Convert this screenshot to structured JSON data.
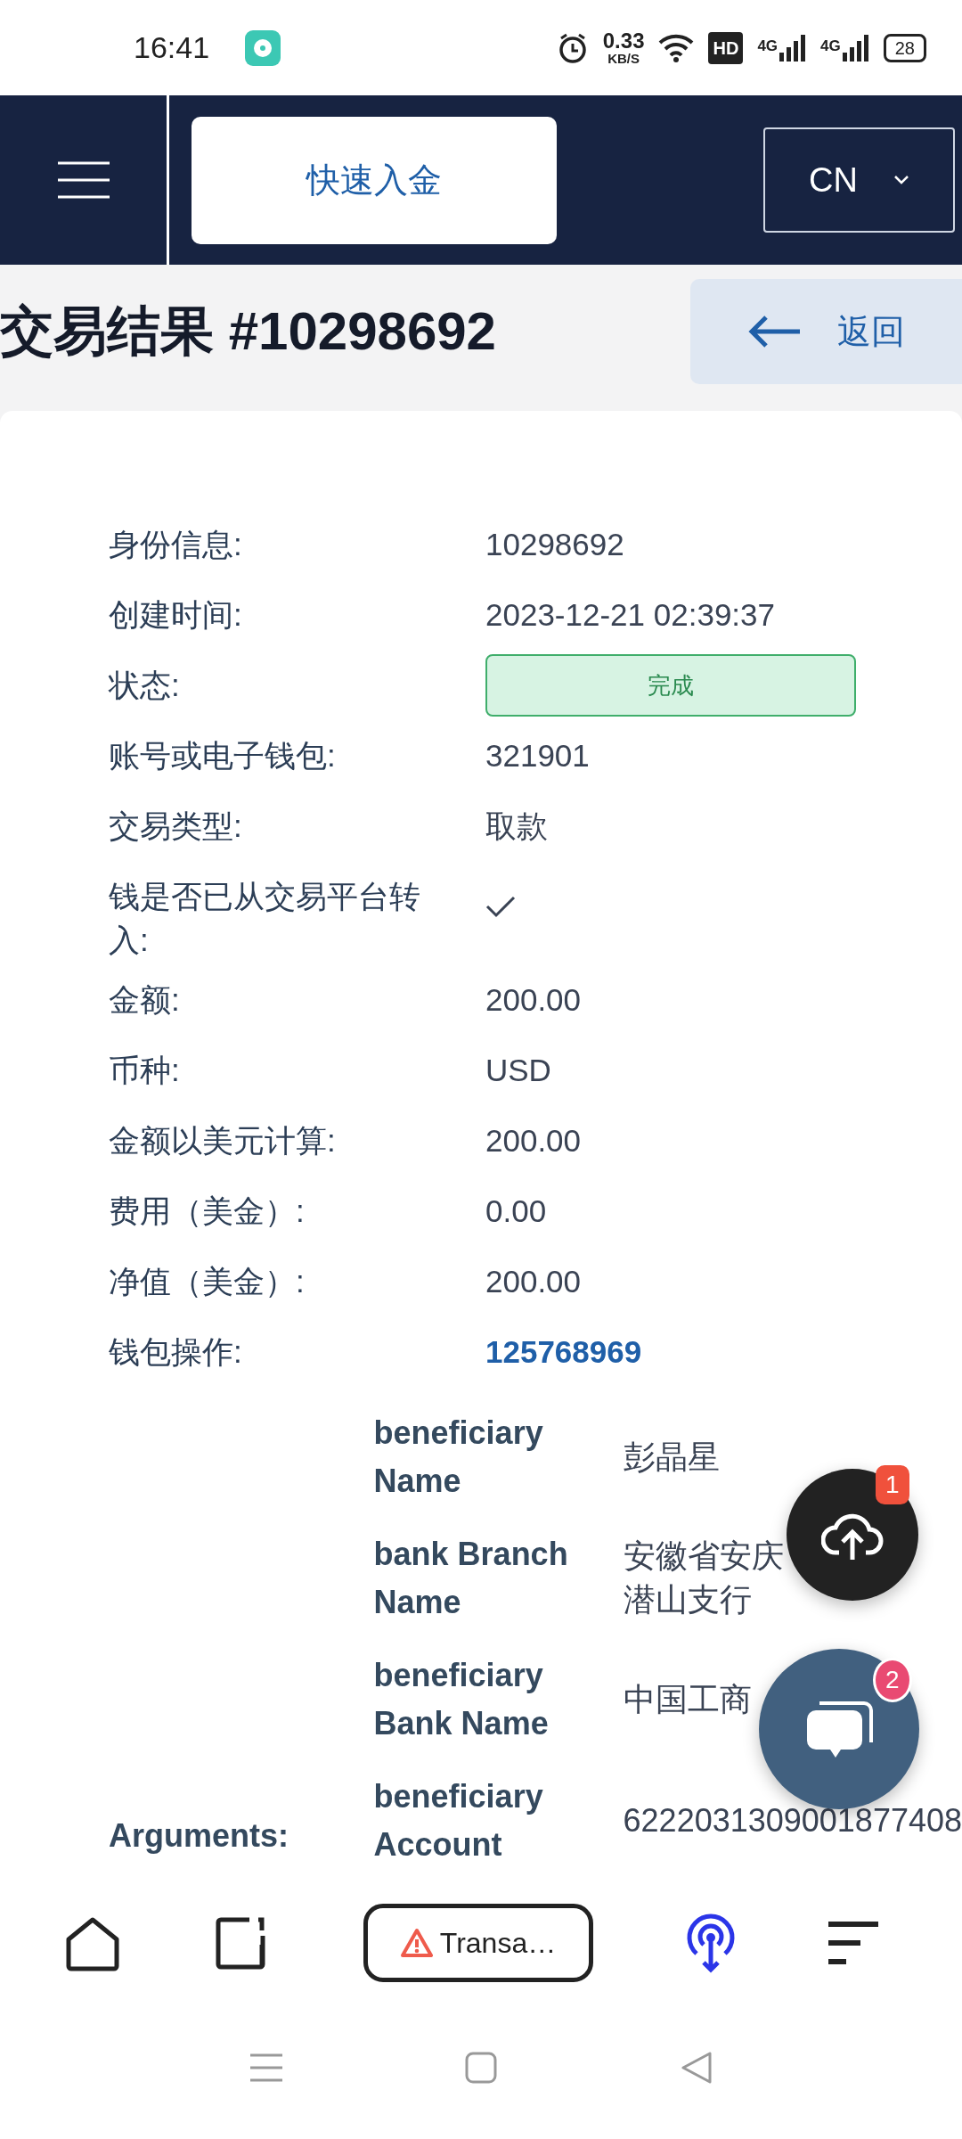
{
  "status_bar": {
    "time": "16:41",
    "speed": "0.33",
    "speed_unit": "KB/S",
    "hd": "HD",
    "networks": [
      "4G",
      "4G"
    ],
    "battery": "28"
  },
  "header": {
    "quick_deposit": "快速入金",
    "language": "CN"
  },
  "title": "交易结果 #10298692",
  "back": "返回",
  "fields": [
    {
      "kind": "text",
      "label": "身份信息:",
      "value": "10298692"
    },
    {
      "kind": "text",
      "label": "创建时间:",
      "value": "2023-12-21 02:39:37"
    },
    {
      "kind": "badge",
      "label": "状态:",
      "value": "完成"
    },
    {
      "kind": "text",
      "label": "账号或电子钱包:",
      "value": "321901"
    },
    {
      "kind": "text",
      "label": "交易类型:",
      "value": "取款"
    },
    {
      "kind": "check",
      "label": "钱是否已从交易平台转入:",
      "checked": true
    },
    {
      "kind": "text",
      "label": "金额:",
      "value": "200.00"
    },
    {
      "kind": "text",
      "label": "币种:",
      "value": "USD"
    },
    {
      "kind": "text",
      "label": "金额以美元计算:",
      "value": "200.00"
    },
    {
      "kind": "text",
      "label": "费用（美金）:",
      "value": "0.00"
    },
    {
      "kind": "text",
      "label": "净值（美金）:",
      "value": "200.00"
    },
    {
      "kind": "link",
      "label": "钱包操作:",
      "value": "125768969"
    }
  ],
  "arguments": {
    "label": "Arguments:",
    "items": [
      {
        "label": "beneficiary Name",
        "value": "彭晶星"
      },
      {
        "label": "bank Branch Name",
        "value": "安徽省安庆潜山支行"
      },
      {
        "label": "beneficiary Bank Name",
        "value": "中国工商"
      },
      {
        "label": "beneficiary Account",
        "value": "6222031309001877408"
      }
    ]
  },
  "fabs": [
    {
      "kind": "upload",
      "badge": "1"
    },
    {
      "kind": "chat",
      "badge": "2"
    }
  ],
  "browser_bar": {
    "tab_title": "Transa…"
  }
}
